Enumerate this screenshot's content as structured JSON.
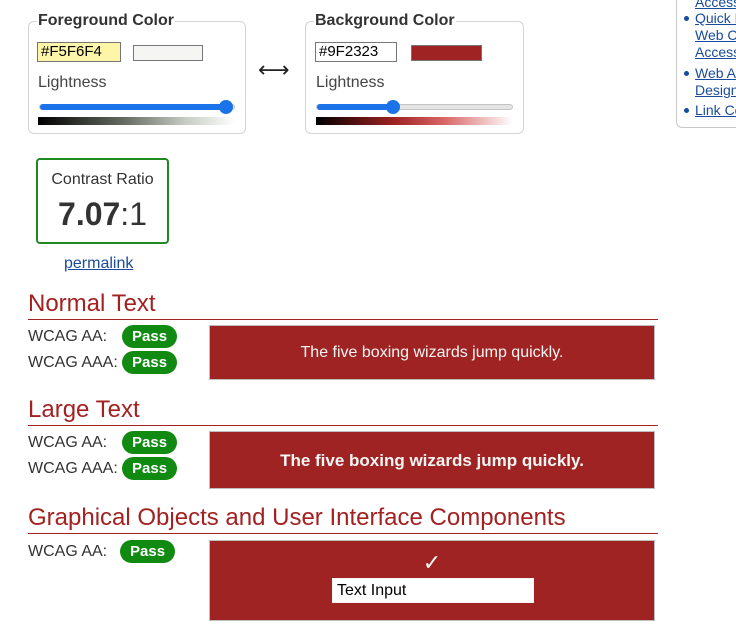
{
  "foreground": {
    "legend": "Foreground Color",
    "hex": "#F5F6F4",
    "swatch_color": "#f5f6f4",
    "lightness_label": "Lightness",
    "lightness": 0.96
  },
  "background": {
    "legend": "Background Color",
    "hex": "#9F2323",
    "swatch_color": "#9f2323",
    "lightness_label": "Lightness",
    "lightness": 0.39
  },
  "swap_icon": "left-right-arrow-icon",
  "swap_glyph": "⟷",
  "sidebar": {
    "links": [
      "Access",
      "Quick R",
      "Web C",
      "Access",
      "Web A",
      "Design",
      "Link Co"
    ]
  },
  "contrast": {
    "label": "Contrast Ratio",
    "ratio": "7.07",
    "suffix": ":1",
    "permalink": "permalink"
  },
  "sections": {
    "normal": {
      "title": "Normal Text",
      "aa_label": "WCAG AA:",
      "aa_result": "Pass",
      "aaa_label": "WCAG AAA:",
      "aaa_result": "Pass",
      "sample": "The five boxing wizards jump quickly."
    },
    "large": {
      "title": "Large Text",
      "aa_label": "WCAG AA:",
      "aa_result": "Pass",
      "aaa_label": "WCAG AAA:",
      "aaa_result": "Pass",
      "sample": "The five boxing wizards jump quickly."
    },
    "graphical": {
      "title": "Graphical Objects and User Interface Components",
      "aa_label": "WCAG AA:",
      "aa_result": "Pass",
      "check_glyph": "✓",
      "input_value": "Text Input"
    }
  },
  "colors": {
    "pass": "#118a11",
    "accent": "#a32121",
    "link": "#1a4b9c",
    "slider": "#1a73e8"
  }
}
